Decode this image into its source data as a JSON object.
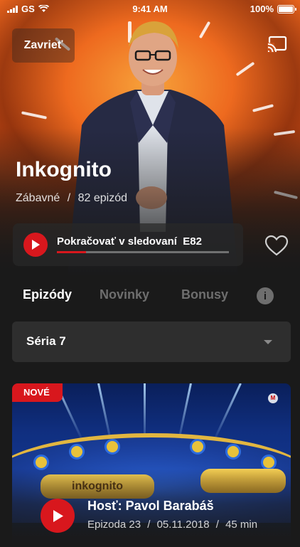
{
  "status_bar": {
    "carrier": "GS",
    "time": "9:41 AM",
    "battery": "100%"
  },
  "header": {
    "close_label": "Zavrieť",
    "cast_icon": "cast-icon"
  },
  "show": {
    "title": "Inkognito",
    "genre": "Zábavné",
    "separator": "/",
    "episode_count": "82 epizód"
  },
  "continue": {
    "label": "Pokračovať v sledovaní",
    "episode": "E82",
    "progress": 0.17
  },
  "favorite_icon": "heart-outline-icon",
  "tabs": [
    {
      "label": "Epizódy",
      "active": true
    },
    {
      "label": "Novinky",
      "active": false
    },
    {
      "label": "Bonusy",
      "active": false
    }
  ],
  "info_label": "i",
  "season_select": {
    "value": "Séria 7"
  },
  "episode": {
    "badge": "NOVÉ",
    "title": "Hosť: Pavol Barabáš",
    "number": "Epizoda 23",
    "date": "05.11.2018",
    "duration": "45 min",
    "separator": "/",
    "desk_logo": "inkognito"
  },
  "colors": {
    "accent": "#d8171d",
    "background": "#1a1a1a",
    "tab_inactive": "#6e6e6e"
  }
}
